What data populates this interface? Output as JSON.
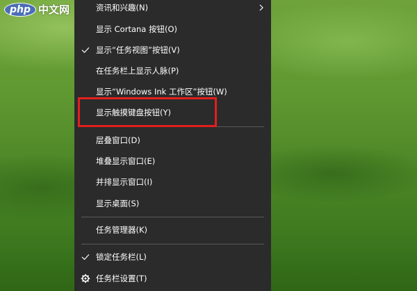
{
  "watermark": {
    "oval": "php",
    "text": "中文网"
  },
  "menu": {
    "items": [
      {
        "label": "资讯和兴趣(N)",
        "checked": false,
        "submenu": true
      },
      {
        "label": "显示 Cortana 按钮(O)",
        "checked": false
      },
      {
        "label": "显示“任务视图”按钮(V)",
        "checked": true
      },
      {
        "label": "在任务栏上显示人脉(P)",
        "checked": false
      },
      {
        "label": "显示“Windows Ink 工作区”按钮(W)",
        "checked": false
      },
      {
        "label": "显示触摸键盘按钮(Y)",
        "checked": false,
        "highlighted": true
      },
      {
        "label": "层叠窗口(D)",
        "checked": false
      },
      {
        "label": "堆叠显示窗口(E)",
        "checked": false
      },
      {
        "label": "并排显示窗口(I)",
        "checked": false
      },
      {
        "label": "显示桌面(S)",
        "checked": false
      },
      {
        "label": "任务管理器(K)",
        "checked": false
      },
      {
        "label": "锁定任务栏(L)",
        "checked": true
      },
      {
        "label": "任务栏设置(T)",
        "icon": "gear-icon"
      }
    ]
  },
  "colors": {
    "menu_background": "#2b2b2b",
    "menu_text": "#ffffff",
    "separator": "#5a5a5a",
    "highlight_border": "#e41e1e"
  }
}
